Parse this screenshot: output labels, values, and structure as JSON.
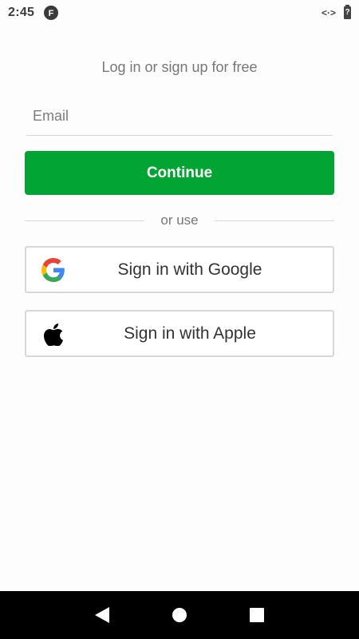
{
  "status_bar": {
    "time": "2:45",
    "app_badge_letter": "F",
    "sync_glyph": "<·>",
    "battery_glyph": "?"
  },
  "auth": {
    "prompt": "Log in or sign up for free",
    "email_placeholder": "Email",
    "email_value": "",
    "continue_label": "Continue",
    "divider_text": "or use",
    "google_label": "Sign in with Google",
    "apple_label": "Sign in with Apple"
  },
  "colors": {
    "continue_bg": "#02a533",
    "nav_bar_bg": "#000000"
  },
  "icons": {
    "google": "google-logo",
    "apple": "apple-logo",
    "back": "nav-back-triangle",
    "home": "nav-home-circle",
    "recents": "nav-recents-square"
  }
}
